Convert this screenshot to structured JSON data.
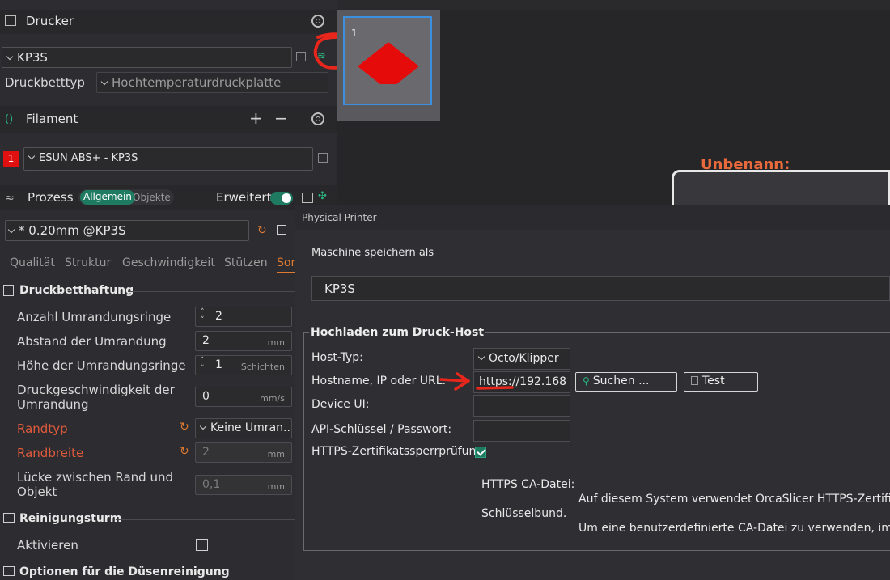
{
  "printer": {
    "section": "Drucker",
    "name": "KP3S",
    "bed_label": "Druckbetttyp",
    "bed_value": "Hochtemperaturdruckplatte"
  },
  "filament": {
    "section": "Filament",
    "index": "1",
    "name": "ESUN ABS+ - KP3S"
  },
  "process": {
    "section": "Prozess",
    "mode_on": "Allgemein",
    "mode_off": "Objekte",
    "advanced": "Erweitert",
    "preset": "* 0.20mm @KP3S"
  },
  "tabs": [
    "Qualität",
    "Struktur",
    "Geschwindigkeit",
    "Stützen",
    "Son"
  ],
  "adhesion": {
    "title": "Druckbetthaftung",
    "rows": [
      {
        "label": "Anzahl Umrandungsringe",
        "value": "2",
        "unit": ""
      },
      {
        "label": "Abstand der Umrandung",
        "value": "2",
        "unit": "mm"
      },
      {
        "label": "Höhe der Umrandungsringe",
        "value": "1",
        "unit": "Schichten"
      },
      {
        "label": "Druckgeschwindigkeit der Umrandung",
        "value": "0",
        "unit": "mm/s"
      },
      {
        "label": "Randtyp",
        "value": "Keine Umran...",
        "unit": ""
      },
      {
        "label": "Randbreite",
        "value": "2",
        "unit": "mm"
      },
      {
        "label": "Lücke zwischen Rand und Objekt",
        "value": "0,1",
        "unit": "mm"
      }
    ]
  },
  "tower": {
    "title": "Reinigungsturm",
    "activate": "Aktivieren"
  },
  "nozzle": {
    "title": "Optionen für die Düsenreinigung"
  },
  "plate": {
    "number": "1",
    "name": "Unbenann:"
  },
  "dialog": {
    "title": "Physical Printer",
    "save_as_label": "Maschine speichern als",
    "save_as_value": "KP3S",
    "group": "Hochladen zum Druck-Host",
    "host_type_label": "Host-Typ:",
    "host_type_value": "Octo/Klipper",
    "hostname_label": "Hostname, IP oder URL:",
    "hostname_value": "https://192.168",
    "search_btn": "Suchen ...",
    "test_btn": "Test",
    "device_ui_label": "Device UI:",
    "api_label": "API-Schlüssel / Passwort:",
    "https_label": "HTTPS-Zertifikatssperrprüfung",
    "ca_label": "HTTPS CA-Datei:",
    "ca_text1": "Auf diesem System verwendet OrcaSlicer HTTPS-Zertifikate",
    "ca_text2": "Schlüsselbund.",
    "ca_text3": "Um eine benutzerdefinierte CA-Datei zu verwenden, impo"
  }
}
